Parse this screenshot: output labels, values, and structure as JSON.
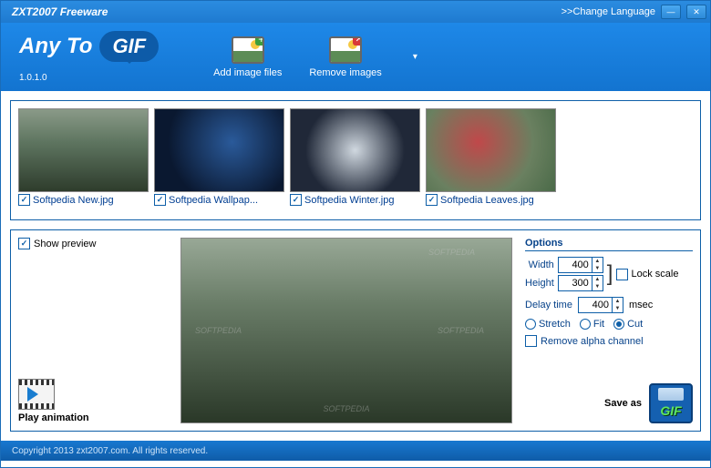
{
  "titlebar": {
    "title": "ZXT2007 Freeware",
    "change_language": ">>Change Language"
  },
  "brand": {
    "any_to": "Any To",
    "gif": "GIF",
    "version": "1.0.1.0"
  },
  "toolbar": {
    "add": "Add image files",
    "remove": "Remove images"
  },
  "thumbs": [
    {
      "name": "Softpedia New.jpg",
      "checked": true,
      "cls": "timg-forest"
    },
    {
      "name": "Softpedia Wallpap...",
      "checked": true,
      "cls": "timg-wall"
    },
    {
      "name": "Softpedia Winter.jpg",
      "checked": true,
      "cls": "timg-winter"
    },
    {
      "name": "Softpedia Leaves.jpg",
      "checked": true,
      "cls": "timg-leaves"
    }
  ],
  "lower": {
    "show_preview": "Show preview",
    "play_animation": "Play animation",
    "watermark": "SOFTPEDIA"
  },
  "options": {
    "title": "Options",
    "width_label": "Width",
    "width": "400",
    "height_label": "Height",
    "height": "300",
    "lock_scale": "Lock scale",
    "delay_label": "Delay time",
    "delay": "400",
    "delay_unit": "msec",
    "stretch": "Stretch",
    "fit": "Fit",
    "cut": "Cut",
    "scale_mode": "cut",
    "remove_alpha": "Remove alpha channel",
    "save_as": "Save as",
    "save_gif": "GIF"
  },
  "footer": "Copyright 2013 zxt2007.com.  All rights reserved."
}
